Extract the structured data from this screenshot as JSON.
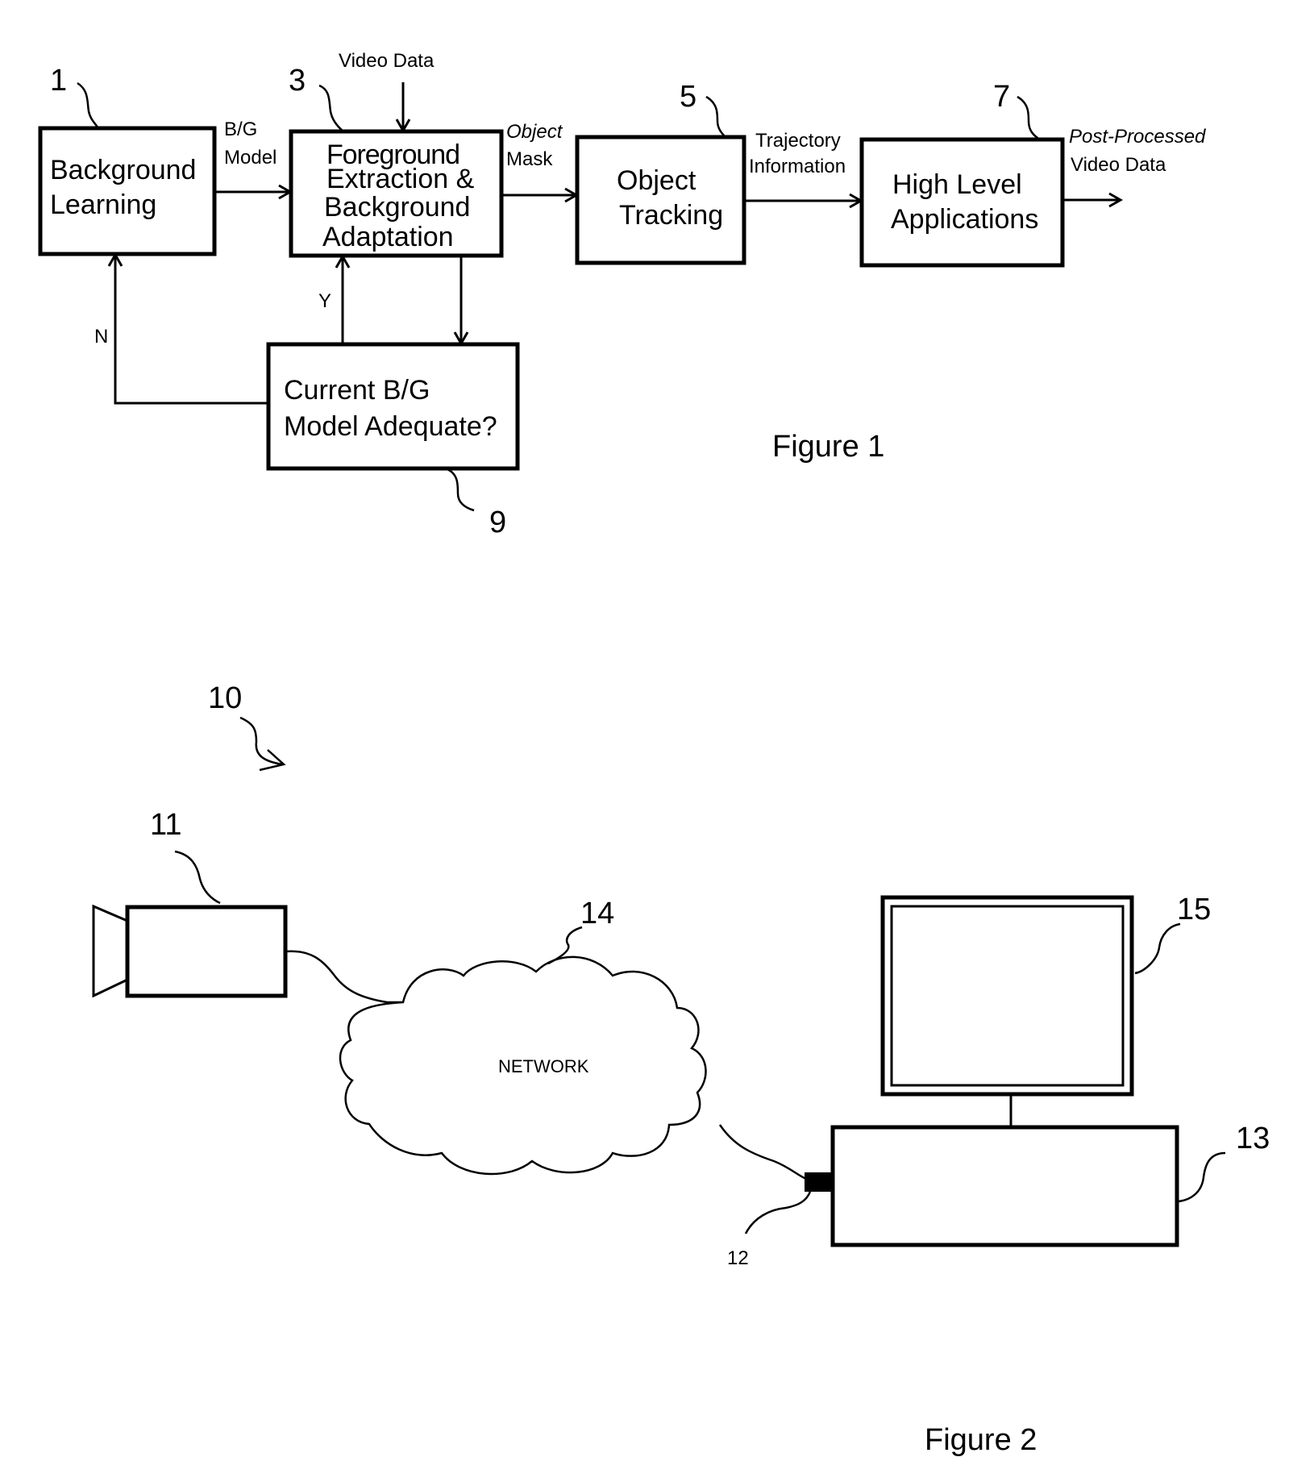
{
  "figure1": {
    "caption": "Figure 1",
    "blocks": {
      "background_learning": {
        "ref": "1",
        "lines": [
          "Background",
          "Learning"
        ]
      },
      "foreground_extraction": {
        "ref": "3",
        "lines": [
          "Foreground",
          "Extraction &",
          "Background",
          "Adaptation"
        ]
      },
      "object_tracking": {
        "ref": "5",
        "lines": [
          "Object",
          "Tracking"
        ]
      },
      "high_level_applications": {
        "ref": "7",
        "lines": [
          "High Level",
          "Applications"
        ]
      },
      "model_adequate_decision": {
        "ref": "9",
        "lines": [
          "Current B/G",
          "Model Adequate?"
        ]
      }
    },
    "edge_labels": {
      "bg_model": [
        "B/G",
        "Model"
      ],
      "video_data": "Video Data",
      "object_mask": [
        "Object",
        "Mask"
      ],
      "trajectory_information": [
        "Trajectory",
        "Information"
      ],
      "post_processed": [
        "Post-Processed",
        "Video Data"
      ],
      "yes": "Y",
      "no": "N"
    }
  },
  "figure2": {
    "caption": "Figure 2",
    "system_ref": "10",
    "camera_ref": "11",
    "connector_ref": "12",
    "computer_ref": "13",
    "network_ref": "14",
    "monitor_ref": "15",
    "network_label": "NETWORK"
  }
}
